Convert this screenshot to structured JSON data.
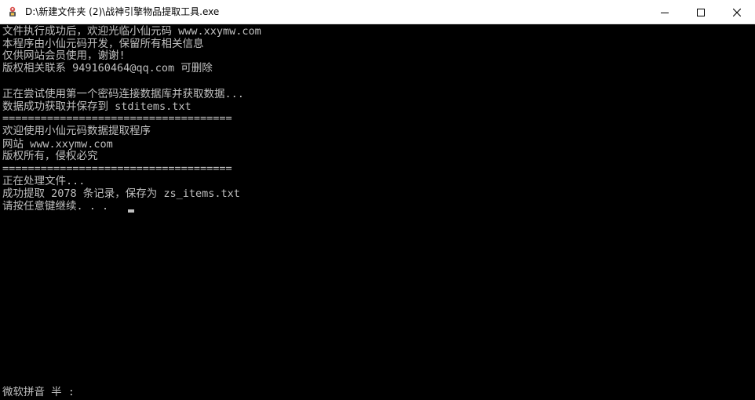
{
  "window": {
    "title": "D:\\新建文件夹 (2)\\战神引擎物品提取工具.exe",
    "icon": "console-app-icon"
  },
  "controls": {
    "minimize_icon": "minimize-icon",
    "maximize_icon": "maximize-icon",
    "close_icon": "close-icon"
  },
  "console": {
    "lines": [
      "文件执行成功后，欢迎光临小仙元码 www.xxymw.com",
      "本程序由小仙元码开发，保留所有相关信息",
      "仅供网站会员使用，谢谢!",
      "版权相关联系 949160464@qq.com 可删除",
      "",
      "正在尝试使用第一个密码连接数据库并获取数据...",
      "数据成功获取并保存到 stditems.txt",
      "====================================",
      "欢迎使用小仙元码数据提取程序",
      "网站 www.xxymw.com",
      "版权所有，侵权必究",
      "====================================",
      "正在处理文件...",
      "成功提取 2078 条记录，保存为 zs_items.txt",
      "请按任意键继续. . . "
    ],
    "ime_status": "微软拼音 半 :"
  },
  "colors": {
    "console_bg": "#000000",
    "console_fg": "#c0c0c0",
    "titlebar_bg": "#ffffff"
  }
}
